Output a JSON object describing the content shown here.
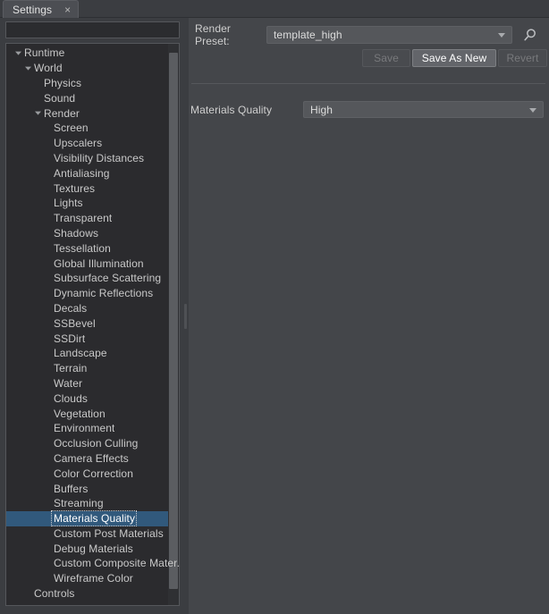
{
  "window": {
    "tab": {
      "label": "Settings",
      "close_icon": "close-icon",
      "close_glyph": "×"
    }
  },
  "colors": {
    "panel_bg": "#44464a",
    "tree_bg": "#2b2b2e",
    "chrome_bg": "#3b3d41",
    "selection": "#31597c",
    "text": "#c9c9c9",
    "text_bright": "#ffffff",
    "text_disabled": "#78797c",
    "control_bg": "#55575b",
    "button_enabled_bg": "#63656a",
    "separator": "#56585c",
    "scrollbar_thumb": "#5b5d61"
  },
  "left_panel": {
    "filter": {
      "value": "",
      "placeholder": ""
    },
    "tree": [
      {
        "label": "Runtime",
        "depth": 0,
        "expander": "expanded"
      },
      {
        "label": "World",
        "depth": 1,
        "expander": "expanded"
      },
      {
        "label": "Physics",
        "depth": 2,
        "expander": "none"
      },
      {
        "label": "Sound",
        "depth": 2,
        "expander": "none"
      },
      {
        "label": "Render",
        "depth": 2,
        "expander": "expanded"
      },
      {
        "label": "Screen",
        "depth": 3,
        "expander": "none"
      },
      {
        "label": "Upscalers",
        "depth": 3,
        "expander": "none"
      },
      {
        "label": "Visibility Distances",
        "depth": 3,
        "expander": "none"
      },
      {
        "label": "Antialiasing",
        "depth": 3,
        "expander": "none"
      },
      {
        "label": "Textures",
        "depth": 3,
        "expander": "none"
      },
      {
        "label": "Lights",
        "depth": 3,
        "expander": "none"
      },
      {
        "label": "Transparent",
        "depth": 3,
        "expander": "none"
      },
      {
        "label": "Shadows",
        "depth": 3,
        "expander": "none"
      },
      {
        "label": "Tessellation",
        "depth": 3,
        "expander": "none"
      },
      {
        "label": "Global Illumination",
        "depth": 3,
        "expander": "none"
      },
      {
        "label": "Subsurface Scattering",
        "depth": 3,
        "expander": "none"
      },
      {
        "label": "Dynamic Reflections",
        "depth": 3,
        "expander": "none"
      },
      {
        "label": "Decals",
        "depth": 3,
        "expander": "none"
      },
      {
        "label": "SSBevel",
        "depth": 3,
        "expander": "none"
      },
      {
        "label": "SSDirt",
        "depth": 3,
        "expander": "none"
      },
      {
        "label": "Landscape",
        "depth": 3,
        "expander": "none"
      },
      {
        "label": "Terrain",
        "depth": 3,
        "expander": "none"
      },
      {
        "label": "Water",
        "depth": 3,
        "expander": "none"
      },
      {
        "label": "Clouds",
        "depth": 3,
        "expander": "none"
      },
      {
        "label": "Vegetation",
        "depth": 3,
        "expander": "none"
      },
      {
        "label": "Environment",
        "depth": 3,
        "expander": "none"
      },
      {
        "label": "Occlusion Culling",
        "depth": 3,
        "expander": "none"
      },
      {
        "label": "Camera Effects",
        "depth": 3,
        "expander": "none"
      },
      {
        "label": "Color Correction",
        "depth": 3,
        "expander": "none"
      },
      {
        "label": "Buffers",
        "depth": 3,
        "expander": "none"
      },
      {
        "label": "Streaming",
        "depth": 3,
        "expander": "none"
      },
      {
        "label": "Materials Quality",
        "depth": 3,
        "expander": "none",
        "selected": true
      },
      {
        "label": "Custom Post Materials",
        "depth": 3,
        "expander": "none"
      },
      {
        "label": "Debug Materials",
        "depth": 3,
        "expander": "none"
      },
      {
        "label": "Custom Composite Mater...",
        "depth": 3,
        "expander": "none"
      },
      {
        "label": "Wireframe Color",
        "depth": 3,
        "expander": "none"
      },
      {
        "label": "Controls",
        "depth": 1,
        "expander": "none"
      }
    ]
  },
  "right_panel": {
    "render_preset": {
      "label": "Render Preset:",
      "value": "template_high",
      "caret_icon": "chevron-down-icon",
      "search_icon": "search-icon"
    },
    "buttons": [
      {
        "label": "Save",
        "state": "disabled"
      },
      {
        "label": "Save As New",
        "state": "enabled"
      },
      {
        "label": "Revert",
        "state": "disabled"
      }
    ],
    "materials_quality": {
      "label": "Materials Quality",
      "value": "High",
      "caret_icon": "chevron-down-icon"
    }
  }
}
